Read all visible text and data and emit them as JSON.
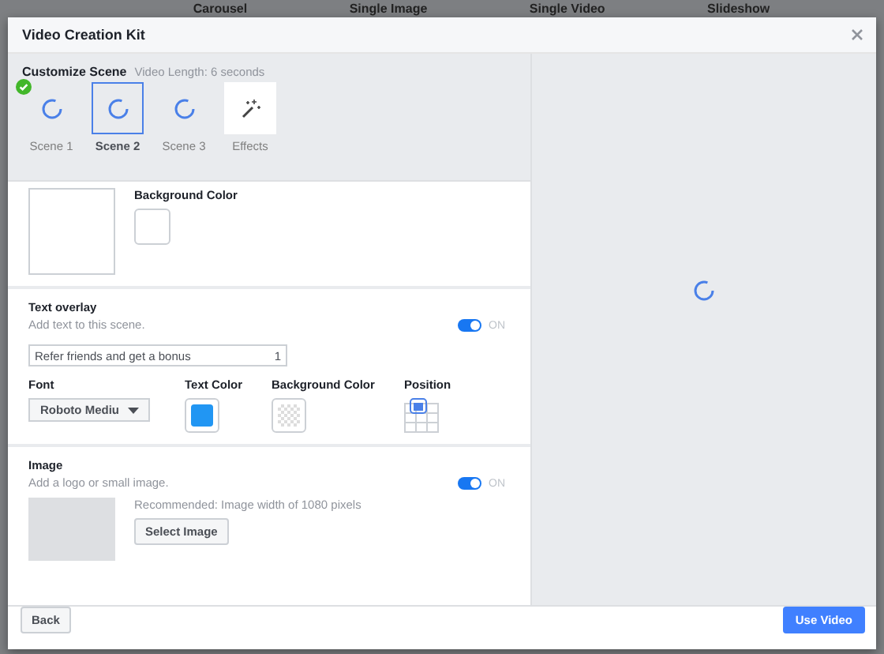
{
  "background_tabs": [
    "Carousel",
    "Single Image",
    "Single Video",
    "Slideshow"
  ],
  "dialog": {
    "title": "Video Creation Kit"
  },
  "customize": {
    "title": "Customize Scene",
    "video_length": "Video Length: 6 seconds"
  },
  "scenes": [
    {
      "label": "Scene 1",
      "kind": "scene",
      "selected": false,
      "completed": true
    },
    {
      "label": "Scene 2",
      "kind": "scene",
      "selected": true,
      "completed": false
    },
    {
      "label": "Scene 3",
      "kind": "scene",
      "selected": false,
      "completed": false
    },
    {
      "label": "Effects",
      "kind": "effects",
      "selected": false,
      "completed": false
    }
  ],
  "scene_settings": {
    "background_color_label": "Background Color"
  },
  "text_overlay": {
    "title": "Text overlay",
    "description": "Add text to this scene.",
    "on": true,
    "toggle_label": "ON",
    "value": "Refer friends and get a bonus",
    "count": "1",
    "font_label": "Font",
    "font_value": "Roboto Mediu",
    "text_color_label": "Text Color",
    "background_color_label": "Background Color",
    "position_label": "Position"
  },
  "image": {
    "title": "Image",
    "description": "Add a logo or small image.",
    "on": true,
    "toggle_label": "ON",
    "recommendation": "Recommended: Image width of 1080 pixels",
    "button": "Select Image"
  },
  "footer": {
    "back": "Back",
    "use_video": "Use Video"
  }
}
